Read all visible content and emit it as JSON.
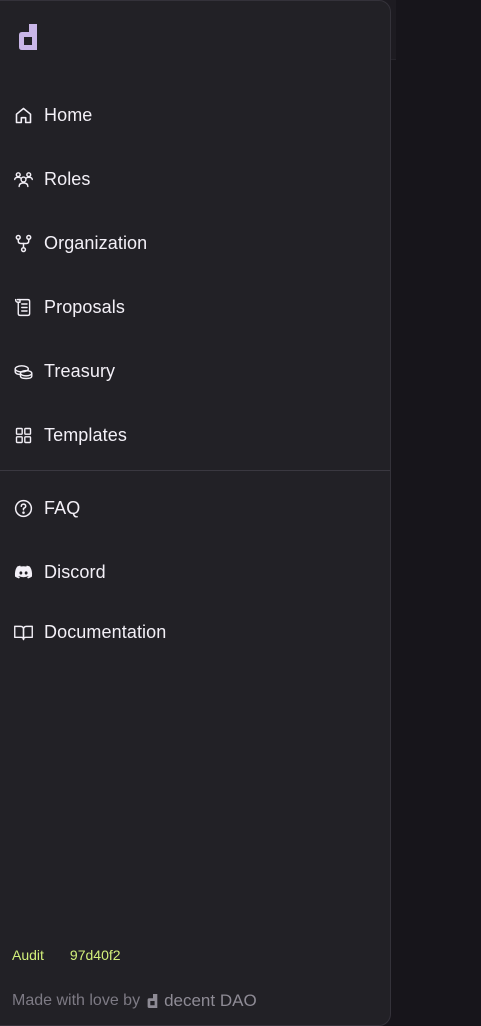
{
  "nav": {
    "items": [
      {
        "label": "Home",
        "icon": "home-icon"
      },
      {
        "label": "Roles",
        "icon": "users-icon"
      },
      {
        "label": "Organization",
        "icon": "git-fork-icon"
      },
      {
        "label": "Proposals",
        "icon": "scroll-icon"
      },
      {
        "label": "Treasury",
        "icon": "coins-icon"
      },
      {
        "label": "Templates",
        "icon": "grid-icon"
      }
    ],
    "secondary": [
      {
        "label": "FAQ",
        "icon": "question-icon"
      },
      {
        "label": "Discord",
        "icon": "discord-icon"
      },
      {
        "label": "Documentation",
        "icon": "book-icon"
      }
    ]
  },
  "audit": {
    "label": "Audit",
    "hash": "97d40f2"
  },
  "footer": {
    "made_with": "Made with love by",
    "brand_name": "decent DAO"
  },
  "colors": {
    "drawer_bg": "#222126",
    "accent_lime": "#d2f07a",
    "text": "#f3f0f7",
    "muted": "#7d7a84",
    "logo": "#c9b6e8"
  }
}
